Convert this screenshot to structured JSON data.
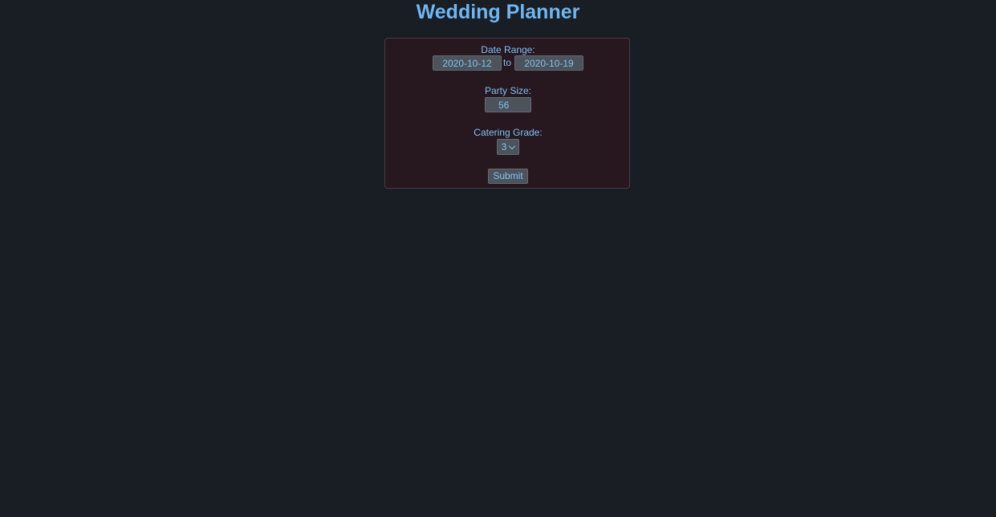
{
  "page": {
    "title": "Wedding Planner"
  },
  "form": {
    "date_range": {
      "label": "Date Range:",
      "start_value": "2020-10-12",
      "separator": "to",
      "end_value": "2020-10-19"
    },
    "party_size": {
      "label": "Party Size:",
      "value": "56"
    },
    "catering_grade": {
      "label": "Catering Grade:",
      "selected": "3"
    },
    "submit_label": "Submit"
  },
  "colors": {
    "background": "#181e24",
    "panel": "#27171f",
    "accent_text": "#6fb6f2",
    "field": "#4c535a"
  },
  "icons": {
    "select_arrow": "chevron-down-icon"
  }
}
